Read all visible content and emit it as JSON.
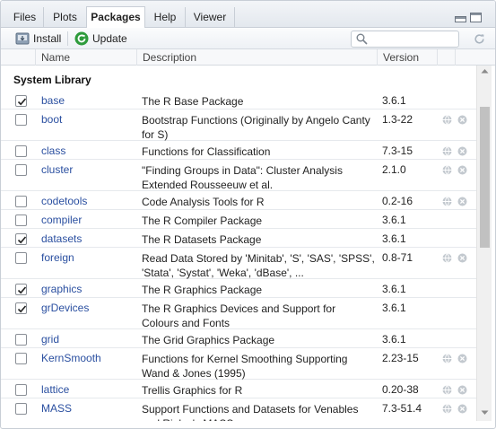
{
  "tabs": [
    {
      "label": "Files",
      "active": false
    },
    {
      "label": "Plots",
      "active": false
    },
    {
      "label": "Packages",
      "active": true
    },
    {
      "label": "Help",
      "active": false
    },
    {
      "label": "Viewer",
      "active": false
    }
  ],
  "toolbar": {
    "install_label": "Install",
    "update_label": "Update",
    "search_placeholder": "",
    "search_value": ""
  },
  "columns": [
    "Name",
    "Description",
    "Version"
  ],
  "group_label": "System Library",
  "colors": {
    "link": "#2a4fa0",
    "update_green": "#2e9b3c"
  },
  "packages": [
    {
      "name": "base",
      "checked": true,
      "description": "The R Base Package",
      "version": "3.6.1",
      "has_actions": false
    },
    {
      "name": "boot",
      "checked": false,
      "description": "Bootstrap Functions (Originally by Angelo Canty for S)",
      "version": "1.3-22",
      "has_actions": true
    },
    {
      "name": "class",
      "checked": false,
      "description": "Functions for Classification",
      "version": "7.3-15",
      "has_actions": true
    },
    {
      "name": "cluster",
      "checked": false,
      "description": "\"Finding Groups in Data\": Cluster Analysis Extended Rousseeuw et al.",
      "version": "2.1.0",
      "has_actions": true
    },
    {
      "name": "codetools",
      "checked": false,
      "description": "Code Analysis Tools for R",
      "version": "0.2-16",
      "has_actions": true
    },
    {
      "name": "compiler",
      "checked": false,
      "description": "The R Compiler Package",
      "version": "3.6.1",
      "has_actions": false
    },
    {
      "name": "datasets",
      "checked": true,
      "description": "The R Datasets Package",
      "version": "3.6.1",
      "has_actions": false
    },
    {
      "name": "foreign",
      "checked": false,
      "description": "Read Data Stored by 'Minitab', 'S', 'SAS', 'SPSS', 'Stata', 'Systat', 'Weka', 'dBase', ...",
      "version": "0.8-71",
      "has_actions": true
    },
    {
      "name": "graphics",
      "checked": true,
      "description": "The R Graphics Package",
      "version": "3.6.1",
      "has_actions": false
    },
    {
      "name": "grDevices",
      "checked": true,
      "description": "The R Graphics Devices and Support for Colours and Fonts",
      "version": "3.6.1",
      "has_actions": false
    },
    {
      "name": "grid",
      "checked": false,
      "description": "The Grid Graphics Package",
      "version": "3.6.1",
      "has_actions": false
    },
    {
      "name": "KernSmooth",
      "checked": false,
      "description": "Functions for Kernel Smoothing Supporting Wand & Jones (1995)",
      "version": "2.23-15",
      "has_actions": true
    },
    {
      "name": "lattice",
      "checked": false,
      "description": "Trellis Graphics for R",
      "version": "0.20-38",
      "has_actions": true
    },
    {
      "name": "MASS",
      "checked": false,
      "description": "Support Functions and Datasets for Venables and Ripley's MASS",
      "version": "7.3-51.4",
      "has_actions": true
    }
  ]
}
